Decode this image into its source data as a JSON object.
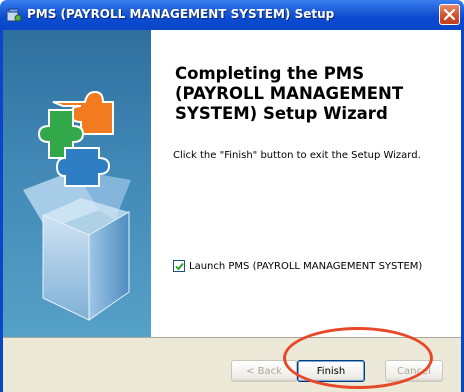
{
  "window": {
    "title": "PMS (PAYROLL MANAGEMENT SYSTEM) Setup",
    "titlebar_color": "#0a46c8",
    "close_color": "#d0512a"
  },
  "content": {
    "heading": "Completing the PMS (PAYROLL MANAGEMENT SYSTEM) Setup Wizard",
    "body": "Click the \"Finish\" button to exit the Setup Wizard.",
    "launch_checkbox": {
      "label": "Launch PMS (PAYROLL MANAGEMENT SYSTEM)",
      "checked": true
    }
  },
  "buttons": {
    "back": "< Back",
    "finish": "Finish",
    "cancel": "Cancel"
  },
  "annotation": {
    "highlight_color": "#e8482a",
    "highlight_target": "finish-button"
  }
}
